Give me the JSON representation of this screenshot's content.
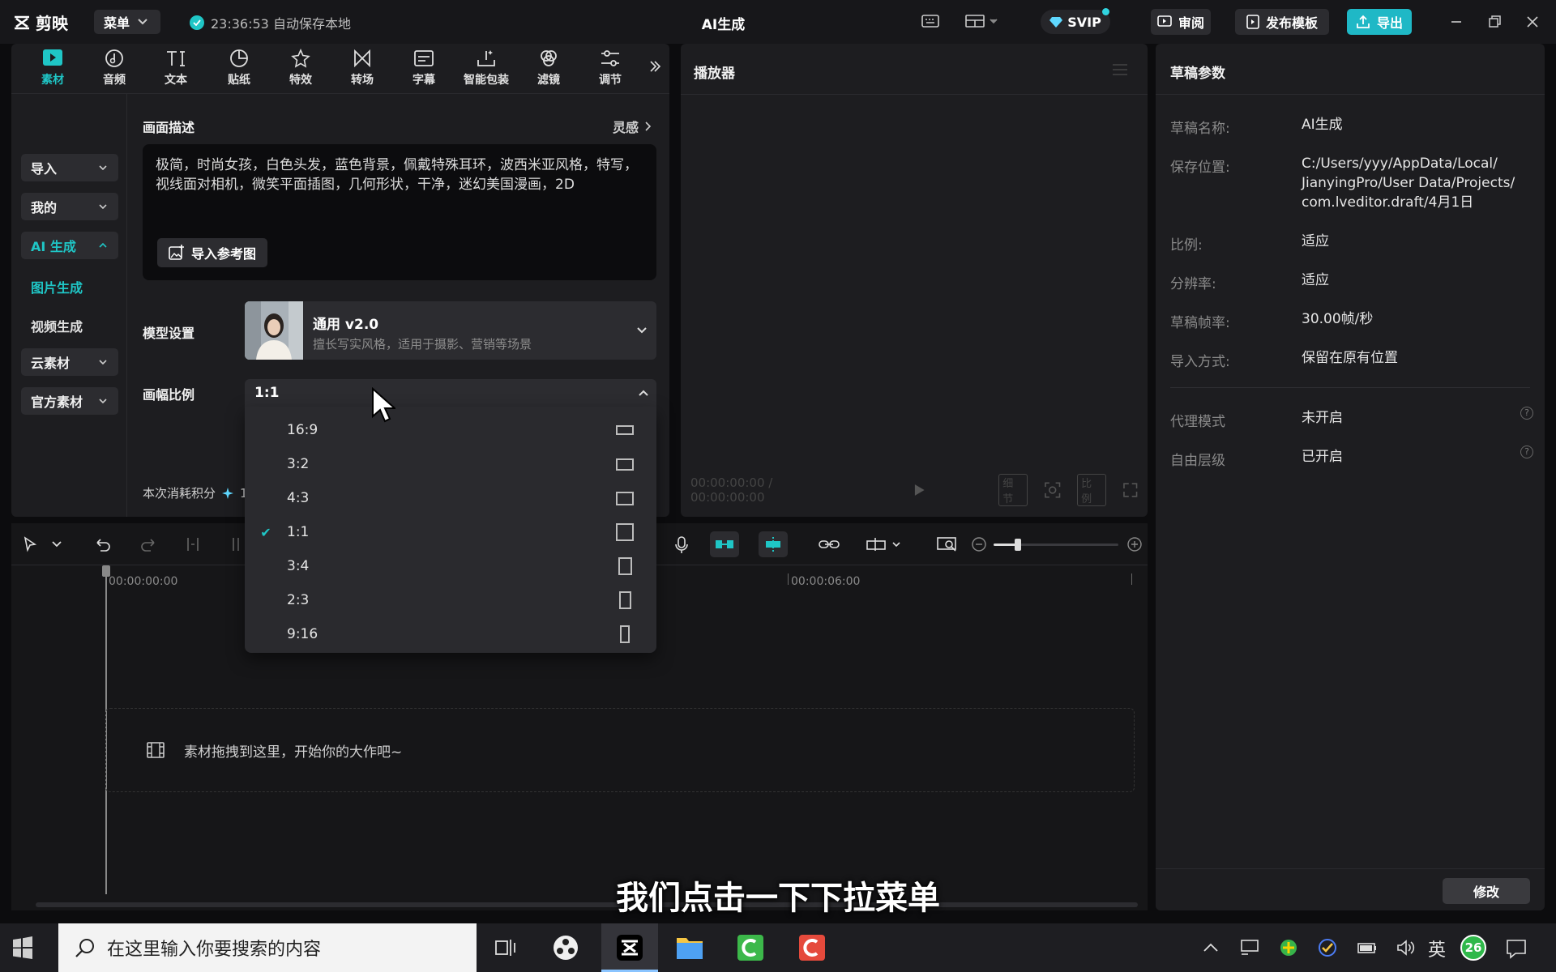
{
  "app": {
    "logo_text": "剪映",
    "menu_label": "菜单",
    "autosave_text": "23:36:53 自动保存本地",
    "window_title": "AI生成",
    "svip_label": "SVIP",
    "review_label": "审阅",
    "publish_template_label": "发布模板",
    "export_label": "导出"
  },
  "toolbar": {
    "items": [
      {
        "label": "素材",
        "icon": "media-icon",
        "active": true
      },
      {
        "label": "音频",
        "icon": "audio-icon"
      },
      {
        "label": "文本",
        "icon": "text-icon"
      },
      {
        "label": "贴纸",
        "icon": "sticker-icon"
      },
      {
        "label": "特效",
        "icon": "effects-icon"
      },
      {
        "label": "转场",
        "icon": "transition-icon"
      },
      {
        "label": "字幕",
        "icon": "caption-icon"
      },
      {
        "label": "智能包装",
        "icon": "smart-pack-icon"
      },
      {
        "label": "滤镜",
        "icon": "filter-icon"
      },
      {
        "label": "调节",
        "icon": "adjust-icon"
      }
    ],
    "more_icon": "chevron-double-right-icon"
  },
  "left_nav": {
    "import": "导入",
    "mine": "我的",
    "ai_gen": "AI 生成",
    "image_gen": "图片生成",
    "video_gen": "视频生成",
    "cloud": "云素材",
    "official": "官方素材"
  },
  "ai_panel": {
    "desc_label": "画面描述",
    "inspiration": "灵感",
    "prompt": "极简，时尚女孩，白色头发，蓝色背景，佩戴特殊耳环，波西米亚风格，特写，视线面对相机，微笑平面插图，几何形状，干净，迷幻美国漫画，2D",
    "import_ref": "导入参考图",
    "model_label": "模型设置",
    "model_name": "通用 v2.0",
    "model_desc": "擅长写实风格，适用于摄影、营销等场景",
    "ratio_label": "画幅比例",
    "ratio_selected": "1:1",
    "cost_label": "本次消耗积分",
    "cost_value": "1"
  },
  "ratio_options": [
    {
      "label": "16:9",
      "w": 16,
      "h": 9
    },
    {
      "label": "3:2",
      "w": 3,
      "h": 2
    },
    {
      "label": "4:3",
      "w": 4,
      "h": 3
    },
    {
      "label": "1:1",
      "w": 1,
      "h": 1,
      "selected": true
    },
    {
      "label": "3:4",
      "w": 3,
      "h": 4
    },
    {
      "label": "2:3",
      "w": 2,
      "h": 3
    },
    {
      "label": "9:16",
      "w": 9,
      "h": 16
    }
  ],
  "player": {
    "title": "播放器",
    "time_current": "00:00:00:00",
    "time_total": "00:00:00:00",
    "btn_detail": "细节",
    "btn_ratio": "比例"
  },
  "draft": {
    "title": "草稿参数",
    "rows": [
      {
        "key": "草稿名称:",
        "value": "AI生成"
      },
      {
        "key": "保存位置:",
        "value": "C:/Users/yyy/AppData/Local/ JianyingPro/User Data/Projects/ com.lveditor.draft/4月1日"
      },
      {
        "key": "比例:",
        "value": "适应"
      },
      {
        "key": "分辨率:",
        "value": "适应"
      },
      {
        "key": "草稿帧率:",
        "value": "30.00帧/秒"
      },
      {
        "key": "导入方式:",
        "value": "保留在原有位置"
      }
    ],
    "proxy_key": "代理模式",
    "proxy_value": "未开启",
    "free_layer_key": "自由层级",
    "free_layer_value": "已开启",
    "help_glyph": "?",
    "modify_label": "修改"
  },
  "timeline": {
    "tick_start": "00:00:00:00",
    "tick_mid": "00:00:06:00",
    "drop_hint": "素材拖拽到这里，开始你的大作吧~"
  },
  "subtitle": "我们点击一下下拉菜单",
  "taskbar": {
    "search_placeholder": "在这里输入你要搜索的内容",
    "ime": "英",
    "notif_count": "26"
  },
  "colors": {
    "accent": "#1fc6c6",
    "bg": "#0c0c0e",
    "panel": "#1d1d20"
  }
}
